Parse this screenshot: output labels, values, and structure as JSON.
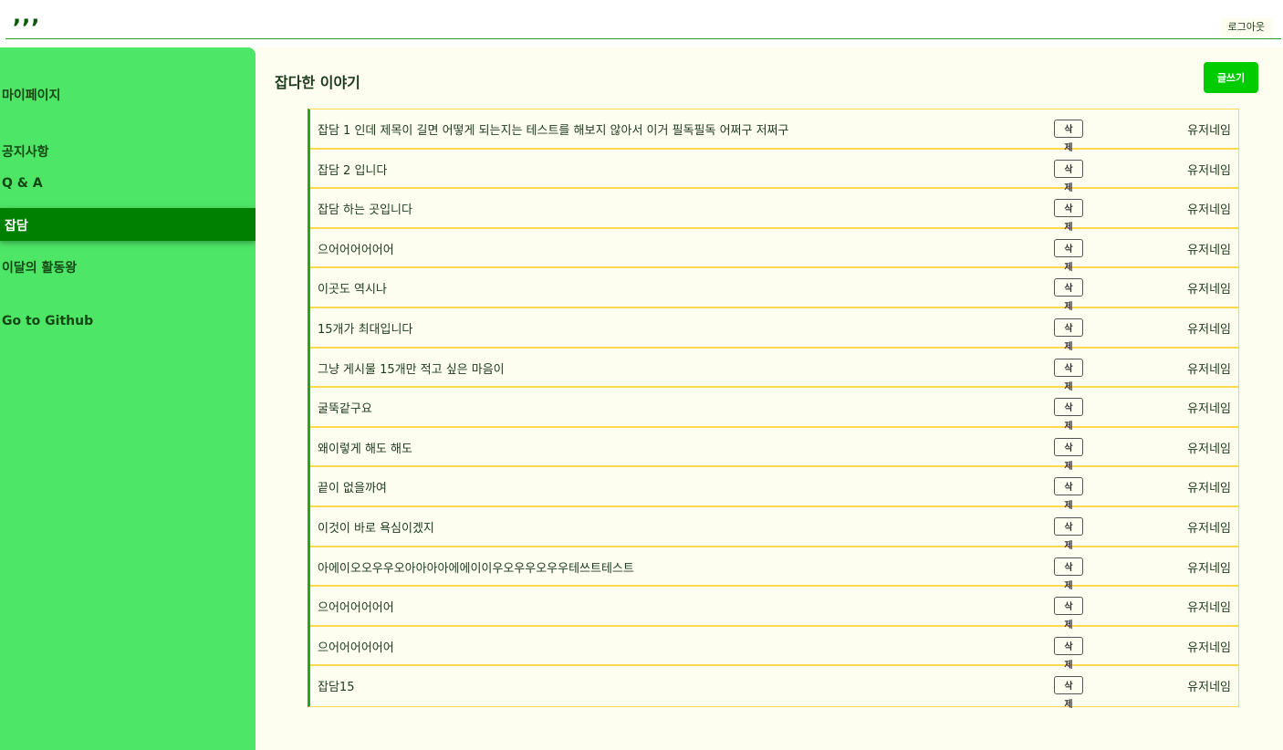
{
  "header": {
    "logo": ",,,",
    "logout_label": "로그아웃"
  },
  "sidebar": {
    "items": [
      {
        "label": "마이페이지"
      },
      {
        "label": "공지사항"
      },
      {
        "label": "Q & A"
      },
      {
        "label": "잡담"
      },
      {
        "label": "이달의 활동왕"
      },
      {
        "label": "Go to Github"
      }
    ],
    "active_index": 3
  },
  "main": {
    "title": "잡다한 이야기",
    "write_label": "글쓰기",
    "delete_label": "삭제",
    "posts": [
      {
        "title": "잡담 1 인데 제목이 길면 어떻게 되는지는 테스트를 해보지 않아서 이거 필독필독 어쩌구 저쩌구",
        "author": "유저네임"
      },
      {
        "title": "잡담 2 입니다",
        "author": "유저네임"
      },
      {
        "title": "잡담 하는 곳입니다",
        "author": "유저네임"
      },
      {
        "title": "으어어어어어어",
        "author": "유저네임"
      },
      {
        "title": "이곳도 역시나",
        "author": "유저네임"
      },
      {
        "title": "15개가 최대입니다",
        "author": "유저네임"
      },
      {
        "title": "그냥 게시물 15개만 적고 싶은 마음이",
        "author": "유저네임"
      },
      {
        "title": "굴뚝같구요",
        "author": "유저네임"
      },
      {
        "title": "왜이렇게 해도 해도",
        "author": "유저네임"
      },
      {
        "title": "끝이 없을까여",
        "author": "유저네임"
      },
      {
        "title": "이것이 바로 욕심이겠지",
        "author": "유저네임"
      },
      {
        "title": "아에이오오우우오아아아아에에이이우오우우오우우테쓰트테스트",
        "author": "유저네임"
      },
      {
        "title": "으어어어어어어",
        "author": "유저네임"
      },
      {
        "title": "으어어어어어어",
        "author": "유저네임"
      },
      {
        "title": "잡담15",
        "author": "유저네임"
      }
    ]
  },
  "colors": {
    "sidebar_bg": "#4de666",
    "active_bg": "#008000",
    "content_bg": "#fdfef0",
    "accent_button": "#00cc00",
    "row_border": "#ffd84d",
    "list_left_border": "#23a623"
  }
}
